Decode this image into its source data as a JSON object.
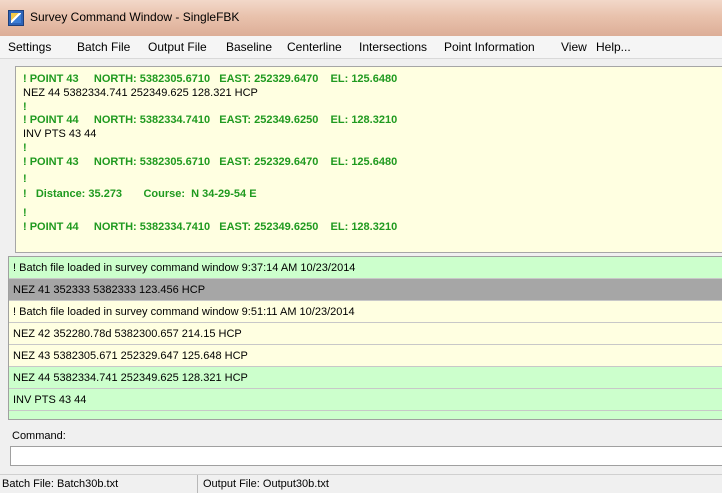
{
  "window": {
    "title": "Survey Command Window - SingleFBK"
  },
  "menu": [
    "Settings",
    "Batch File",
    "Output File",
    "Baseline",
    "Centerline",
    "Intersections",
    "Point Information",
    "View",
    "Help..."
  ],
  "output_lines": [
    {
      "text": "! POINT 43     NORTH: 5382305.6710   EAST: 252329.6470    EL: 125.6480",
      "style": "green"
    },
    {
      "text": "NEZ 44 5382334.741 252349.625 128.321 HCP",
      "style": "black"
    },
    {
      "text": "!",
      "style": "green"
    },
    {
      "text": "! POINT 44     NORTH: 5382334.7410   EAST: 252349.6250    EL: 128.3210",
      "style": "green"
    },
    {
      "text": "INV PTS 43 44",
      "style": "black"
    },
    {
      "text": "!",
      "style": "green"
    },
    {
      "text": "! POINT 43     NORTH: 5382305.6710   EAST: 252329.6470    EL: 125.6480",
      "style": "green"
    },
    {
      "text": "!",
      "style": "green"
    },
    {
      "text": "!   Distance: 35.273       Course:  N 34-29-54 E",
      "style": "green"
    },
    {
      "text": "!",
      "style": "green"
    },
    {
      "text": "! POINT 44     NORTH: 5382334.7410   EAST: 252349.6250    EL: 128.3210",
      "style": "green"
    }
  ],
  "batch_rows": [
    {
      "text": "! Batch file loaded in survey command window 9:37:14 AM  10/23/2014",
      "style": "green"
    },
    {
      "text": "NEZ 41 352333 5382333 123.456 HCP",
      "style": "gray"
    },
    {
      "text": "! Batch file loaded in survey command window 9:51:11 AM  10/23/2014",
      "style": "yellow"
    },
    {
      "text": "NEZ 42 352280.78d 5382300.657 214.15 HCP",
      "style": "yellow"
    },
    {
      "text": "NEZ 43 5382305.671 252329.647 125.648 HCP",
      "style": "yellow"
    },
    {
      "text": "NEZ 44 5382334.741 252349.625 128.321 HCP",
      "style": "green"
    },
    {
      "text": "INV PTS 43 44",
      "style": "green"
    },
    {
      "text": "",
      "style": "green"
    }
  ],
  "command": {
    "label": "Command:",
    "value": ""
  },
  "status": {
    "batch_file": "Batch File: Batch30b.txt",
    "output_file": "Output File: Output30b.txt"
  },
  "colors": {
    "output_bg": "#ffffe1",
    "green_text": "#1f9a1f",
    "row_green": "#ccffcc",
    "row_selected": "#a6a6a6"
  }
}
